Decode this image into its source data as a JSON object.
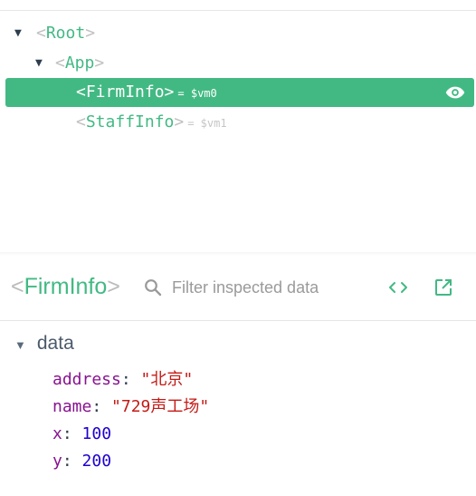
{
  "tree": {
    "root": {
      "open": "<",
      "name": "Root",
      "close": ">"
    },
    "app": {
      "open": "<",
      "name": "App",
      "close": ">"
    },
    "firm": {
      "open": "<",
      "name": "FirmInfo",
      "close": ">",
      "vm": "= $vm0"
    },
    "staff": {
      "open": "<",
      "name": "StaffInfo",
      "close": ">",
      "vm": "= $vm1"
    }
  },
  "inspector": {
    "open": "<",
    "component": "FirmInfo",
    "close": ">",
    "filter_placeholder": "Filter inspected data"
  },
  "data_section": {
    "title": "data",
    "props": [
      {
        "key": "address",
        "value": "\"北京\""
      },
      {
        "key": "name",
        "value": "\"729声工场\""
      },
      {
        "key": "x",
        "value": "100"
      },
      {
        "key": "y",
        "value": "200"
      }
    ]
  },
  "colors": {
    "accent": "#42b983",
    "key": "#881391",
    "string": "#c41a16",
    "number": "#1c00cf"
  },
  "icons": [
    "expand-arrow-icon",
    "eye-icon",
    "search-icon",
    "code-icon",
    "open-in-new-icon"
  ]
}
